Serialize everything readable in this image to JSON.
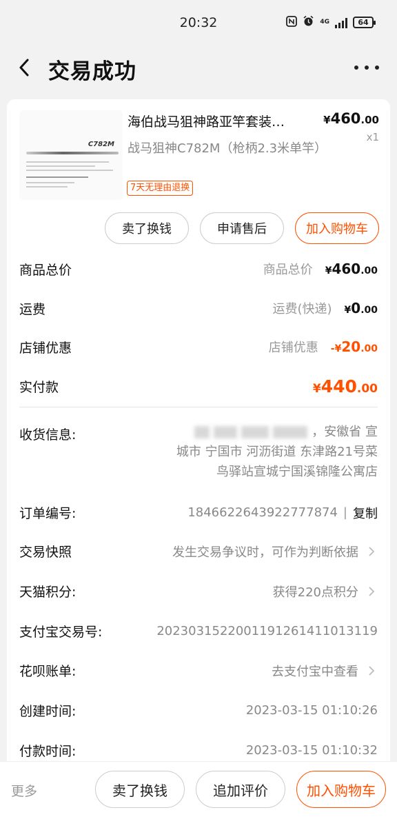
{
  "status_bar": {
    "time": "20:32",
    "network": "4G",
    "battery": "64"
  },
  "header": {
    "title": "交易成功"
  },
  "product": {
    "thumb_model": "C782M",
    "title": "海伯战马狙神路亚竿套装…",
    "sku": "战马狙神C782M（枪柄2.3米单竿）",
    "return_tag": "7天无理由退换",
    "price_currency": "¥",
    "price_int": "460",
    "price_dec": ".00",
    "qty": "x1"
  },
  "item_actions": {
    "sell": "卖了换钱",
    "after_sale": "申请售后",
    "add_cart": "加入购物车"
  },
  "summary": {
    "goods_total": {
      "label": "商品总价",
      "sub": "商品总价",
      "cur": "¥",
      "int": "460",
      "dec": ".00"
    },
    "shipping": {
      "label": "运费",
      "sub": "运费(快递)",
      "cur": "¥",
      "int": "0",
      "dec": ".00"
    },
    "shop_discount": {
      "label": "店铺优惠",
      "sub": "店铺优惠",
      "cur": "-¥",
      "int": "20",
      "dec": ".00"
    },
    "paid": {
      "label": "实付款",
      "cur": "¥",
      "int": "440",
      "dec": ".00"
    }
  },
  "order_info": {
    "address_label": "收货信息:",
    "address_line1_tail": "，安徽省 宣",
    "address_line2": "城市 宁国市 河沥街道 东津路21号菜",
    "address_line3": "鸟驿站宣城宁国溪锦隆公寓店",
    "order_no_label": "订单编号:",
    "order_no": "1846622643922777874",
    "copy": "复制",
    "snapshot_label": "交易快照",
    "snapshot_value": "发生交易争议时，可作为判断依据",
    "points_label": "天猫积分:",
    "points_value": "获得220点积分",
    "alipay_label": "支付宝交易号:",
    "alipay_value": "2023031522001191261411013119",
    "huabei_label": "花呗账单:",
    "huabei_value": "去支付宝中查看",
    "created_label": "创建时间:",
    "created_value": "2023-03-15 01:10:26",
    "paid_label": "付款时间:",
    "paid_value": "2023-03-15 01:10:32"
  },
  "bottom_bar": {
    "more": "更多",
    "sell": "卖了换钱",
    "add_review": "追加评价",
    "add_cart": "加入购物车"
  },
  "colors": {
    "accent": "#ff5000",
    "background": "#f2f2f2"
  }
}
